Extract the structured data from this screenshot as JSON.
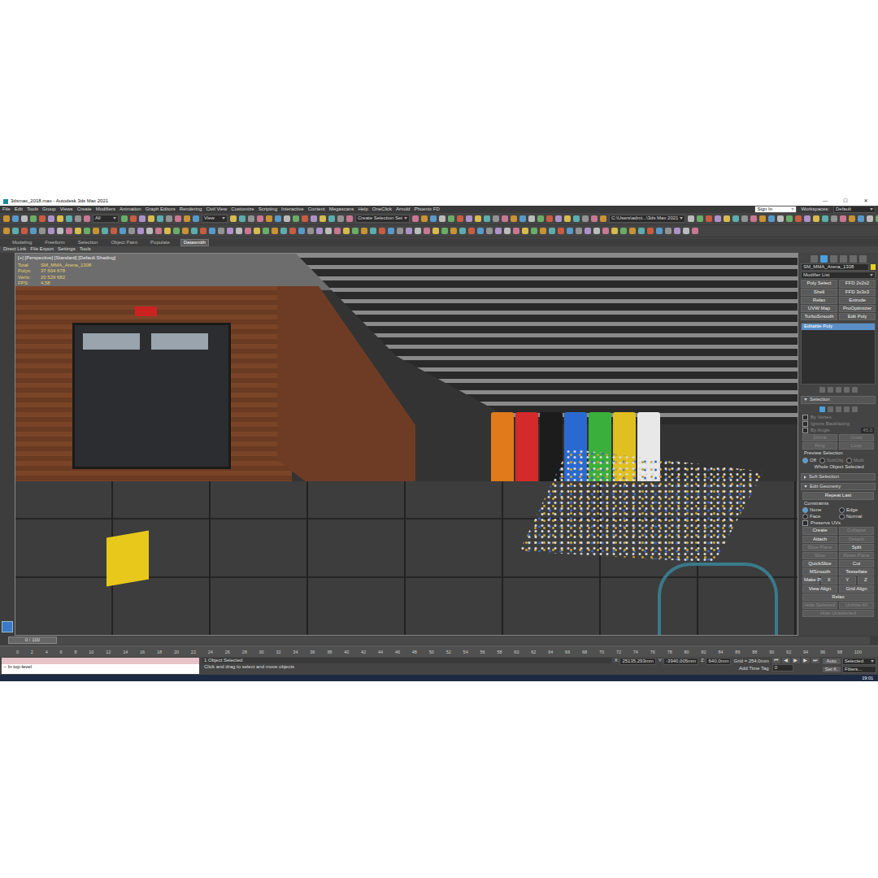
{
  "window": {
    "title": "3dsmax_2018.max - Autodesk 3ds Max 2021",
    "controls": [
      "—",
      "☐",
      "✕"
    ]
  },
  "menu": [
    "File",
    "Edit",
    "Tools",
    "Group",
    "Views",
    "Create",
    "Modifiers",
    "Animation",
    "Graph Editors",
    "Rendering",
    "Civil View",
    "Customize",
    "Scripting",
    "Interactive",
    "Content",
    "Megascans",
    "Help",
    "OneClick",
    "Arnold",
    "Phoenix FD"
  ],
  "account": {
    "sign_in": "Sign In",
    "workspaces_label": "Workspaces:",
    "workspace": "Default"
  },
  "toolbar": {
    "fields": [
      "All",
      "View",
      "Create Selection Set",
      "C:\\Users\\admi...\\3ds Max 2021"
    ]
  },
  "ribbon_tabs": [
    {
      "label": "Modeling",
      "selected": false
    },
    {
      "label": "Freeform",
      "selected": false
    },
    {
      "label": "Selection",
      "selected": false
    },
    {
      "label": "Object Paint",
      "selected": false
    },
    {
      "label": "Populate",
      "selected": false
    },
    {
      "label": "Datasmith",
      "selected": true
    }
  ],
  "ribbon_items": [
    "Direct Link",
    "File Export",
    "Settings",
    "Tools"
  ],
  "viewport": {
    "label": "[+] [Perspective] [Standard] [Default Shading]",
    "stats": [
      {
        "name": "Total",
        "value": "SM_MMA_Arena_1308"
      },
      {
        "name": "Polys:",
        "value": "37 604 678"
      },
      {
        "name": "Verts:",
        "value": "20 529 682"
      },
      {
        "name": "FPS:",
        "value": "4,58"
      }
    ]
  },
  "command_panel": {
    "object_name": "SM_MMA_Arena_1308",
    "modifier_list": "Modifier List",
    "modifier_buttons": [
      "Poly Select",
      "FFD 2x2x2",
      "Shell",
      "FFD 3x3x3",
      "Relax",
      "Extrude",
      "UVW Map",
      "ProOptimizer",
      "TurboSmooth",
      "Edit Poly"
    ],
    "stack": [
      {
        "label": "Editable Poly",
        "selected": true
      }
    ],
    "selection": {
      "title": "Selection",
      "expanded": true,
      "checks": [
        {
          "label": "By Vertex",
          "checked": false
        },
        {
          "label": "Ignore Backfacing",
          "checked": false
        },
        {
          "label": "By Angle",
          "checked": false
        }
      ],
      "angle": "45,0",
      "buttons": [
        {
          "label": "Shrink",
          "disabled": true
        },
        {
          "label": "Grow",
          "disabled": true
        },
        {
          "label": "Ring",
          "disabled": true
        },
        {
          "label": "Loop",
          "disabled": true
        }
      ],
      "preview_label": "Preview Selection",
      "preview": [
        {
          "label": "Off",
          "selected": true
        },
        {
          "label": "SubObj",
          "selected": false
        },
        {
          "label": "Multi",
          "selected": false
        }
      ],
      "status": "Whole Object Selected"
    },
    "soft_selection": {
      "title": "Soft Selection",
      "expanded": false
    },
    "edit_geometry": {
      "title": "Edit Geometry",
      "expanded": true,
      "repeat_last": "Repeat Last",
      "constraints_label": "Constraints",
      "constraints": [
        {
          "label": "None",
          "selected": true
        },
        {
          "label": "Edge",
          "selected": false
        },
        {
          "label": "Face",
          "selected": false
        },
        {
          "label": "Normal",
          "selected": false
        }
      ],
      "preserve_uvs": {
        "label": "Preserve UVs",
        "checked": false
      },
      "button_rows": [
        [
          {
            "label": "Create",
            "disabled": false
          },
          {
            "label": "Collapse",
            "disabled": true
          }
        ],
        [
          {
            "label": "Attach",
            "disabled": false
          },
          {
            "label": "Detach",
            "disabled": true
          }
        ],
        [
          {
            "label": "Slice Plane",
            "disabled": true
          },
          {
            "label": "Split",
            "disabled": false
          }
        ],
        [
          {
            "label": "Slice",
            "disabled": true
          },
          {
            "label": "Reset Plane",
            "disabled": true
          }
        ],
        [
          {
            "label": "QuickSlice",
            "disabled": false
          },
          {
            "label": "Cut",
            "disabled": false
          }
        ],
        [
          {
            "label": "MSmooth",
            "disabled": false
          },
          {
            "label": "Tessellate",
            "disabled": false
          }
        ],
        [
          {
            "label": "Make Planar",
            "disabled": false
          },
          {
            "label": "X",
            "disabled": false
          },
          {
            "label": "Y",
            "disabled": false
          },
          {
            "label": "Z",
            "disabled": false
          }
        ],
        [
          {
            "label": "View Align",
            "disabled": false
          },
          {
            "label": "Grid Align",
            "disabled": false
          }
        ],
        [
          {
            "label": "Relax",
            "disabled": false
          }
        ],
        [
          {
            "label": "Hide Selected",
            "disabled": true
          },
          {
            "label": "Unhide All",
            "disabled": true
          }
        ],
        [
          {
            "label": "Hide Unselected",
            "disabled": true
          }
        ]
      ]
    }
  },
  "timeline": {
    "frame": "0 / 100",
    "level": 0,
    "ticks": [
      "0",
      "2",
      "4",
      "6",
      "8",
      "10",
      "12",
      "14",
      "16",
      "18",
      "20",
      "22",
      "24",
      "26",
      "28",
      "30",
      "32",
      "34",
      "36",
      "38",
      "40",
      "42",
      "44",
      "46",
      "48",
      "50",
      "52",
      "54",
      "56",
      "58",
      "60",
      "62",
      "64",
      "66",
      "68",
      "70",
      "72",
      "74",
      "76",
      "78",
      "80",
      "82",
      "84",
      "86",
      "88",
      "90",
      "92",
      "94",
      "96",
      "98",
      "100"
    ]
  },
  "status": {
    "listener": "-- In top-level",
    "selection": "1 Object Selected",
    "prompt": "Click and drag to select and move objects",
    "coords": [
      {
        "axis": "X:",
        "value": "25135,293mm"
      },
      {
        "axis": "Y:",
        "value": "-3940,005mm"
      },
      {
        "axis": "Z:",
        "value": "640,0mm"
      }
    ],
    "grid": "Grid = 254,0mm",
    "time_tag": "Add Time Tag",
    "playback": [
      "⏮",
      "◀",
      "▶",
      "▶",
      "⏭"
    ],
    "frame": "0",
    "auto": "Auto",
    "key_filter": "Selected",
    "set_key": "Set K.",
    "filters": "Filters...",
    "clock": "19:01"
  }
}
